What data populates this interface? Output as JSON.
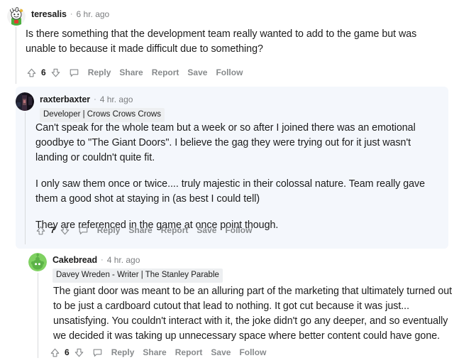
{
  "colors": {
    "page_background": "#ffffff",
    "highlight_background": "#f4f7fc",
    "flair_background": "#edeff1",
    "muted_text": "#878a8c",
    "body_text": "#1c1c1c",
    "thread_line": "#d8dadc"
  },
  "action_labels": {
    "reply": "Reply",
    "share": "Share",
    "report": "Report",
    "save": "Save",
    "follow": "Follow",
    "upvote_icon": "upvote-arrow-icon",
    "downvote_icon": "downvote-arrow-icon",
    "comment_icon": "comment-bubble-icon"
  },
  "comments": [
    {
      "id": "comment-1",
      "username": "teresalis",
      "separator": "·",
      "timestamp": "6 hr. ago",
      "flair": null,
      "avatar": "cartoon-snoo-avatar",
      "score": "6",
      "paragraphs": [
        "Is there something that the development team really wanted to add to the game but was unable to because it made difficult due to something?"
      ]
    },
    {
      "id": "comment-2",
      "username": "raxterbaxter",
      "separator": "·",
      "timestamp": "4 hr. ago",
      "flair": "Developer | Crows Crows Crows",
      "avatar": "photo-avatar",
      "score": "7",
      "paragraphs": [
        "Can't speak for the whole team but a week or so after I joined there was an emotional goodbye to \"The Giant Doors\". I believe the gag they were trying out for it just wasn't landing or couldn't quite fit.",
        "I only saw them once or twice.... truly majestic in their colossal nature. Team really gave them a good shot at staying in (as best I could tell)",
        "They are referenced in the game at once point though."
      ]
    },
    {
      "id": "comment-3",
      "username": "Cakebread",
      "separator": "·",
      "timestamp": "4 hr. ago",
      "flair": "Davey Wreden - Writer | The Stanley Parable",
      "avatar": "green-snoo-avatar",
      "score": "6",
      "paragraphs": [
        "The giant door was meant to be an alluring part of the marketing that ultimately turned out to be just a cardboard cutout that lead to nothing. It got cut because it was just... unsatisfying. You couldn't interact with it, the joke didn't go any deeper, and so eventually we decided it was taking up unnecessary space where better content could have gone."
      ]
    }
  ]
}
